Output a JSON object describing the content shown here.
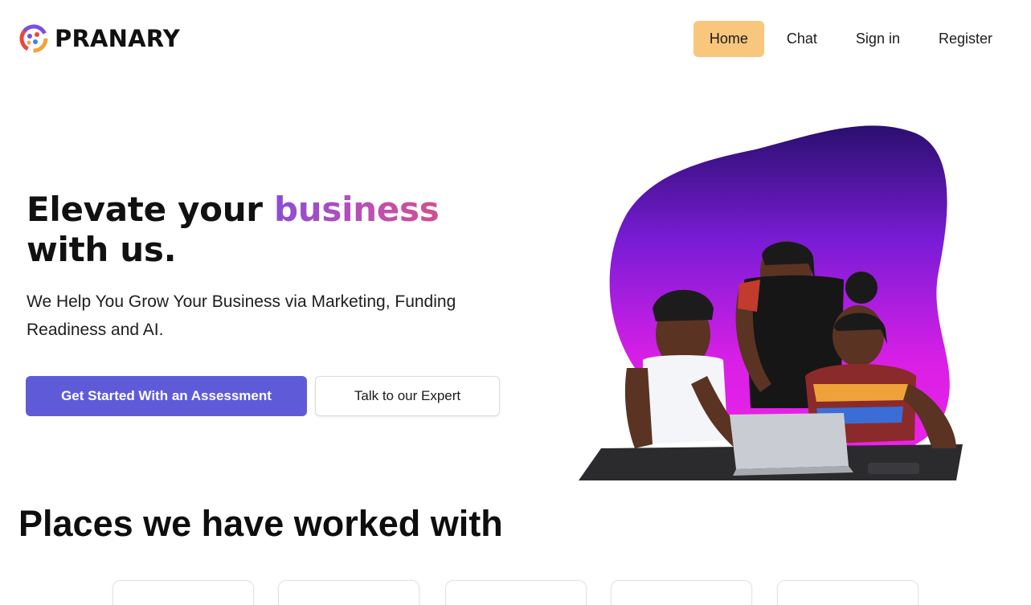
{
  "brand": {
    "name": "PRANARY",
    "logo_icon": "pranary-logo-icon",
    "logo_colors": [
      "#e8483f",
      "#f2a33a",
      "#7b4fe0",
      "#3b82f6"
    ]
  },
  "nav": {
    "items": [
      {
        "label": "Home",
        "active": true
      },
      {
        "label": "Chat",
        "active": false
      },
      {
        "label": "Sign in",
        "active": false
      },
      {
        "label": "Register",
        "active": false
      }
    ],
    "active_color": "#f9c67d"
  },
  "hero": {
    "title_prefix": "Elevate your ",
    "title_accent": "business",
    "title_suffix": "with us.",
    "subtitle": "We Help You Grow Your Business via Marketing, Funding Readiness and AI.",
    "primary_button": "Get Started With an Assessment",
    "secondary_button": "Talk to our Expert",
    "primary_color": "#5f5bd8",
    "image_icon": "team-working-on-laptop-image"
  },
  "places": {
    "title": "Places we have worked with",
    "cards": [
      {},
      {},
      {},
      {},
      {}
    ]
  }
}
